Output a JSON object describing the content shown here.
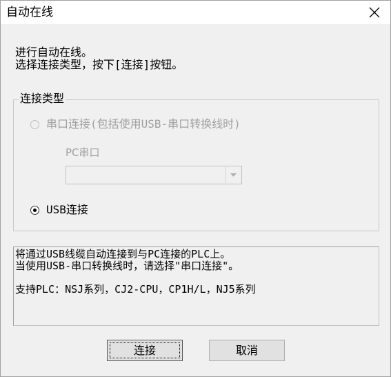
{
  "window": {
    "title": "自动在线"
  },
  "intro": {
    "line1": "进行自动在线。",
    "line2": "选择连接类型，按下[连接]按钮。"
  },
  "connection_type": {
    "group_label": "连接类型",
    "serial_option": {
      "label": "串口连接(包括使用USB-串口转换线时)",
      "checked": false,
      "enabled": false
    },
    "pc_port_label": "PC串口",
    "pc_port_value": "",
    "usb_option": {
      "label": "USB连接",
      "checked": true,
      "enabled": true
    }
  },
  "info": {
    "line1": "将通过USB线缆自动连接到与PC连接的PLC上。",
    "line2": "当使用USB-串口转换线时，请选择\"串口连接\"。",
    "line3": "支持PLC：NSJ系列，CJ2-CPU，CP1H/L，NJ5系列"
  },
  "buttons": {
    "connect": "连接",
    "cancel": "取消"
  }
}
